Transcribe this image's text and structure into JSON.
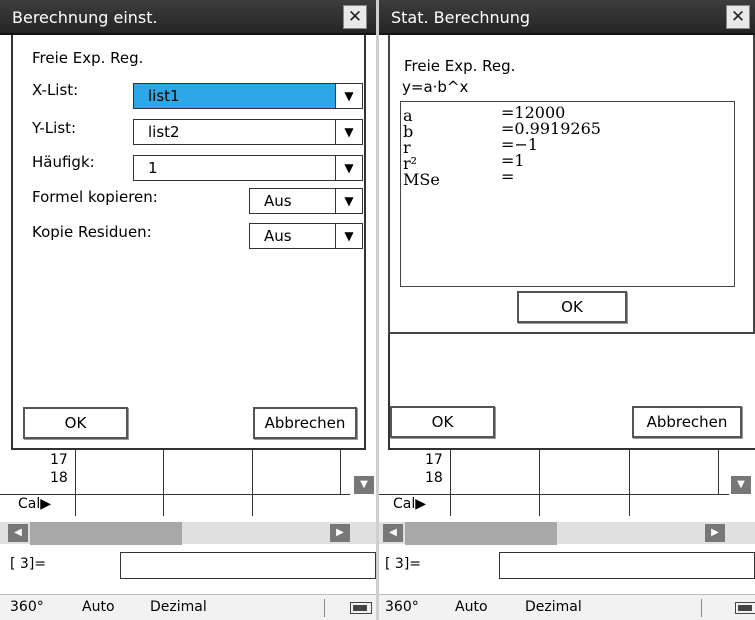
{
  "left": {
    "title": "Berechnung einst.",
    "close_glyph": "✕",
    "regression": "Freie Exp. Reg.",
    "x_list": {
      "label": "X-List:",
      "value": "list1"
    },
    "y_list": {
      "label": "Y-List:",
      "value": "list2"
    },
    "freq": {
      "label": "Häufigk:",
      "value": "1"
    },
    "copy_formula": {
      "label": "Formel kopieren:",
      "value": "Aus"
    },
    "copy_residuals": {
      "label": "Kopie Residuen:",
      "value": "Aus"
    },
    "ok": "OK",
    "cancel": "Abbrechen"
  },
  "right": {
    "title": "Stat. Berechnung",
    "close_glyph": "✕",
    "regression": "Freie Exp. Reg.",
    "formula": "y=a·b^x",
    "results": [
      {
        "name": "a",
        "value": "=12000"
      },
      {
        "name": "b",
        "value": "=0.9919265"
      },
      {
        "name": "r",
        "value": "=−1"
      },
      {
        "name": "r²",
        "value": "=1"
      },
      {
        "name": "MSe",
        "value": "="
      }
    ],
    "ok": "OK",
    "bg_ok": "OK",
    "bg_cancel": "Abbrechen"
  },
  "sheet": {
    "row17": "17",
    "row18": "18",
    "cal": "Cal▶",
    "entry_label": "[  3]=",
    "arrow_down": "▼",
    "arrow_left": "◀",
    "arrow_right": "▶"
  },
  "status": {
    "angle": "360°",
    "mode": "Auto",
    "format": "Dezimal"
  },
  "dropdown_glyph": "▼",
  "colors": {
    "selected_field": "#2da8e6",
    "titlebar": "#2e2e2e"
  }
}
